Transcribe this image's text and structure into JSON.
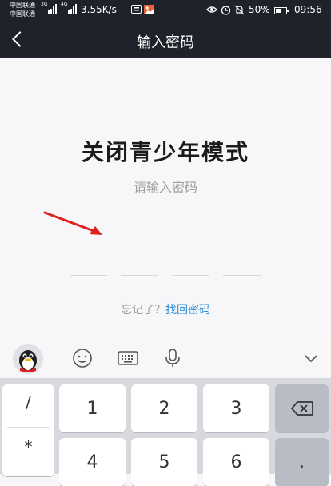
{
  "status_bar": {
    "carrier_1": "中国联通",
    "carrier_2": "中国联通",
    "net_1": "3G",
    "net_2": "4G",
    "speed": "3.55K/s",
    "battery": "50%",
    "battery_level": 0.5,
    "time": "09:56",
    "icons": [
      "sim-card-icon",
      "notification-image-icon",
      "eye-icon",
      "alarm-icon",
      "bell-off-icon",
      "battery-icon"
    ]
  },
  "nav": {
    "title": "输入密码",
    "back_icon": "back-chevron-icon"
  },
  "main": {
    "title": "关闭青少年模式",
    "subtitle": "请输入密码",
    "pin_slots": 4,
    "forgot_prefix": "忘记了？",
    "forgot_link": "找回密码",
    "link_color": "#2c8bd8",
    "arrow_color": "#e02020"
  },
  "keyboard_toolbar": {
    "icons": [
      "qq-avatar-icon",
      "emoji-icon",
      "keyboard-icon",
      "microphone-icon",
      "chevron-down-icon"
    ]
  },
  "keyboard": {
    "symbols": [
      "/",
      "*"
    ],
    "row1": [
      "1",
      "2",
      "3"
    ],
    "row2": [
      "4",
      "5",
      "6"
    ],
    "backspace_icon": "backspace-icon",
    "dot": "."
  }
}
